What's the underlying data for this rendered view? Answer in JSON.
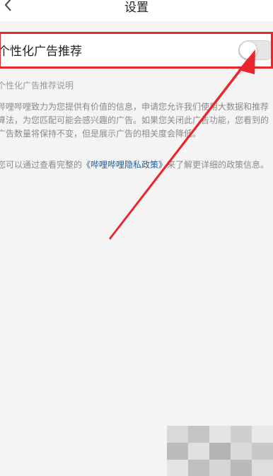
{
  "header": {
    "title": "设置"
  },
  "setting_row": {
    "label": "个性化广告推荐",
    "toggle_on": false
  },
  "description": {
    "section_title": "个性化广告推荐说明",
    "paragraph1": "哔哩哔哩致力为您提供有价值的信息，申请您允许我们使用大数据和推荐算法，为您匹配可能会感兴趣的广告。如果您关闭此广告功能，您看到的广告数量将保持不变，但是展示广告的相关度会降低。",
    "paragraph2_prefix": "您可以通过查看完整的",
    "paragraph2_link": "《哔哩哔哩隐私政策》",
    "paragraph2_suffix": "来了解更详细的政策信息。"
  },
  "colors": {
    "highlight": "#e8262b",
    "link": "#1f5fa0",
    "background": "#f4f4f4"
  }
}
